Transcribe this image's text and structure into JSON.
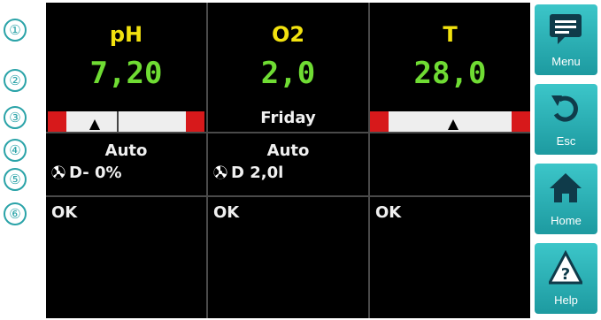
{
  "row_markers": [
    "①",
    "②",
    "③",
    "④",
    "⑤",
    "⑥"
  ],
  "columns": [
    {
      "title": "pH",
      "value": "7,20",
      "indicator": "range-bar",
      "marker_position": 0.3,
      "mode": "Auto",
      "dose": "D- 0%",
      "dose_icon": "dosing-icon",
      "status": "OK"
    },
    {
      "title": "O2",
      "value": "2,0",
      "day": "Friday",
      "mode": "Auto",
      "dose": "D 2,0l",
      "dose_icon": "dosing-icon",
      "status": "OK"
    },
    {
      "title": "T",
      "value": "28,0",
      "indicator": "range-bar",
      "marker_position": 0.52,
      "status": "OK"
    }
  ],
  "sidebar": {
    "menu": {
      "label": "Menu",
      "icon": "speech-bubble-icon"
    },
    "esc": {
      "label": "Esc",
      "icon": "undo-arrow-icon"
    },
    "home": {
      "label": "Home",
      "icon": "home-icon"
    },
    "help": {
      "label": "Help",
      "icon": "warning-help-icon"
    }
  },
  "colors": {
    "title": "#f2e20f",
    "value": "#6fdc33",
    "accent": "#2aa3a8",
    "alarm": "#d7191b"
  }
}
